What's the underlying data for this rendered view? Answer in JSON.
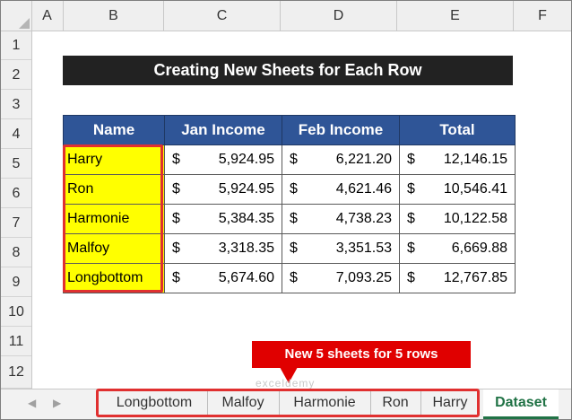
{
  "columns": [
    "A",
    "B",
    "C",
    "D",
    "E",
    "F"
  ],
  "rows": [
    "1",
    "2",
    "3",
    "4",
    "5",
    "6",
    "7",
    "8",
    "9",
    "10",
    "11",
    "12"
  ],
  "title": "Creating New Sheets for Each Row",
  "table": {
    "headers": [
      "Name",
      "Jan Income",
      "Feb Income",
      "Total"
    ],
    "currency": "$",
    "rows": [
      {
        "name": "Harry",
        "jan": "5,924.95",
        "feb": "6,221.20",
        "total": "12,146.15"
      },
      {
        "name": "Ron",
        "jan": "5,924.95",
        "feb": "4,621.46",
        "total": "10,546.41"
      },
      {
        "name": "Harmonie",
        "jan": "5,384.35",
        "feb": "4,738.23",
        "total": "10,122.58"
      },
      {
        "name": "Malfoy",
        "jan": "3,318.35",
        "feb": "3,351.53",
        "total": "6,669.88"
      },
      {
        "name": "Longbottom",
        "jan": "5,674.60",
        "feb": "7,093.25",
        "total": "12,767.85"
      }
    ]
  },
  "callout": "New 5 sheets for 5 rows",
  "tabs": [
    "Longbottom",
    "Malfoy",
    "Harmonie",
    "Ron",
    "Harry",
    "Dataset"
  ],
  "active_tab": "Dataset",
  "watermark": "exceldemy",
  "colors": {
    "header_blue": "#2f5597",
    "name_fill": "#ffff00",
    "highlight_red": "#e00000",
    "active_tab_green": "#217346"
  }
}
